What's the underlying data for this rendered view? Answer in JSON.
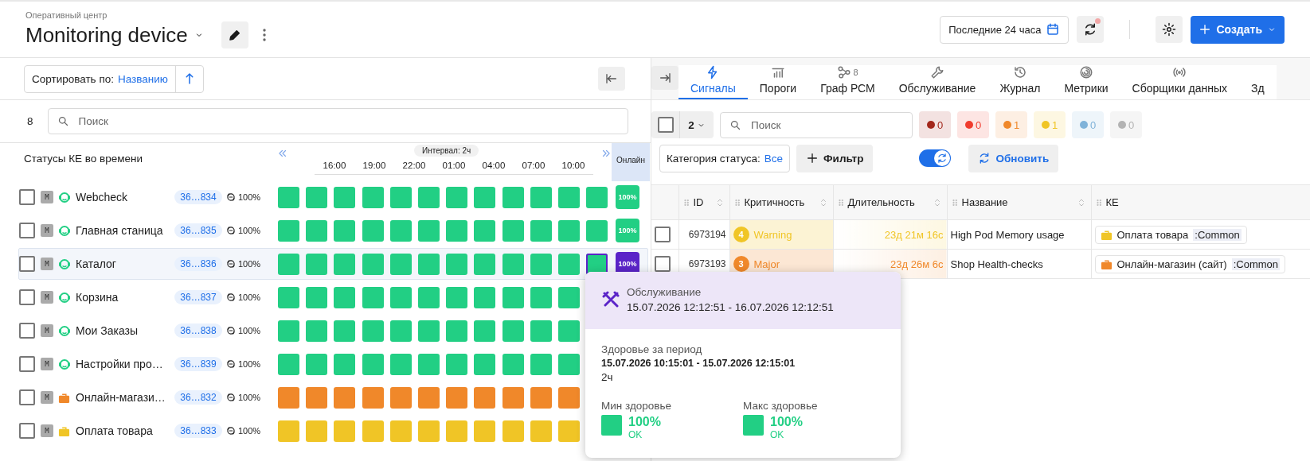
{
  "header": {
    "breadcrumb": "Оперативный центр",
    "title": "Monitoring device",
    "period": "Последние 24 часа",
    "create": "Создать",
    "refresh_alert": true
  },
  "sort": {
    "label": "Сортировать по:",
    "value": "Названию"
  },
  "search": {
    "count": "8",
    "placeholder": "Поиск"
  },
  "timeline": {
    "title": "Статусы КЕ во времени",
    "interval": "Интервал: 2ч",
    "ticks": [
      "16:00",
      "19:00",
      "22:00",
      "01:00",
      "04:00",
      "07:00",
      "10:00"
    ],
    "online_header": "Онлайн"
  },
  "items": [
    {
      "badge": "M",
      "kind": "web",
      "color": "#22cf84",
      "name": "Webcheck",
      "id": "36…834",
      "health": "100%",
      "selected": false,
      "online": "100%",
      "cells": [
        {
          "color": "#22cf84"
        },
        {
          "color": "#22cf84"
        },
        {
          "color": "#22cf84"
        },
        {
          "color": "#22cf84"
        },
        {
          "color": "#22cf84"
        },
        {
          "color": "#22cf84"
        },
        {
          "color": "#22cf84"
        },
        {
          "color": "#22cf84"
        },
        {
          "color": "#22cf84"
        },
        {
          "color": "#22cf84"
        },
        {
          "color": "#22cf84"
        },
        {
          "color": "#22cf84"
        }
      ]
    },
    {
      "badge": "M",
      "kind": "web",
      "color": "#22cf84",
      "name": "Главная станица",
      "id": "36…835",
      "health": "100%",
      "selected": false,
      "online": "100%",
      "cells": [
        {
          "color": "#22cf84"
        },
        {
          "color": "#22cf84"
        },
        {
          "color": "#22cf84"
        },
        {
          "color": "#22cf84"
        },
        {
          "color": "#22cf84"
        },
        {
          "color": "#22cf84"
        },
        {
          "color": "#22cf84"
        },
        {
          "color": "#22cf84"
        },
        {
          "color": "#22cf84"
        },
        {
          "color": "#22cf84"
        },
        {
          "color": "#22cf84"
        },
        {
          "color": "#22cf84"
        }
      ]
    },
    {
      "badge": "M",
      "kind": "web",
      "color": "#22cf84",
      "name": "Каталог",
      "id": "36…836",
      "health": "100%",
      "selected": true,
      "online": "100%",
      "cells": [
        {
          "color": "#22cf84"
        },
        {
          "color": "#22cf84"
        },
        {
          "color": "#22cf84"
        },
        {
          "color": "#22cf84"
        },
        {
          "color": "#22cf84"
        },
        {
          "color": "#22cf84"
        },
        {
          "color": "#22cf84"
        },
        {
          "color": "#22cf84"
        },
        {
          "color": "#22cf84"
        },
        {
          "color": "#22cf84"
        },
        {
          "color": "#22cf84"
        },
        {
          "color": "#22cf84"
        }
      ]
    },
    {
      "badge": "M",
      "kind": "web",
      "color": "#22cf84",
      "name": "Корзина",
      "id": "36…837",
      "health": "100%",
      "selected": false,
      "cells": [
        {
          "color": "#22cf84"
        },
        {
          "color": "#22cf84"
        },
        {
          "color": "#22cf84"
        },
        {
          "color": "#22cf84"
        },
        {
          "color": "#22cf84"
        },
        {
          "color": "#22cf84"
        },
        {
          "color": "#22cf84"
        },
        {
          "color": "#22cf84"
        },
        {
          "color": "#22cf84"
        },
        {
          "color": "#22cf84"
        },
        {
          "color": "#22cf84"
        }
      ]
    },
    {
      "badge": "M",
      "kind": "web",
      "color": "#22cf84",
      "name": "Мои Заказы",
      "id": "36…838",
      "health": "100%",
      "selected": false,
      "cells": [
        {
          "color": "#22cf84"
        },
        {
          "color": "#22cf84"
        },
        {
          "color": "#22cf84"
        },
        {
          "color": "#22cf84"
        },
        {
          "color": "#22cf84"
        },
        {
          "color": "#22cf84"
        },
        {
          "color": "#22cf84"
        },
        {
          "color": "#22cf84"
        },
        {
          "color": "#22cf84"
        },
        {
          "color": "#22cf84"
        },
        {
          "color": "#22cf84"
        }
      ]
    },
    {
      "badge": "M",
      "kind": "web",
      "color": "#22cf84",
      "name": "Настройки про…",
      "id": "36…839",
      "health": "100%",
      "selected": false,
      "cells": [
        {
          "color": "#22cf84"
        },
        {
          "color": "#22cf84"
        },
        {
          "color": "#22cf84"
        },
        {
          "color": "#22cf84"
        },
        {
          "color": "#22cf84"
        },
        {
          "color": "#22cf84"
        },
        {
          "color": "#22cf84"
        },
        {
          "color": "#22cf84"
        },
        {
          "color": "#22cf84"
        },
        {
          "color": "#22cf84"
        },
        {
          "color": "#22cf84"
        }
      ]
    },
    {
      "badge": "M",
      "kind": "service",
      "color": "#f0882a",
      "name": "Онлайн-магази…",
      "id": "36…832",
      "health": "100%",
      "selected": false,
      "cells": [
        {
          "color": "#f0882a"
        },
        {
          "color": "#f0882a"
        },
        {
          "color": "#f0882a"
        },
        {
          "color": "#f0882a"
        },
        {
          "color": "#f0882a"
        },
        {
          "color": "#f0882a"
        },
        {
          "color": "#f0882a"
        },
        {
          "color": "#f0882a"
        },
        {
          "color": "#f0882a"
        },
        {
          "color": "#f0882a"
        },
        {
          "color": "#f0882a"
        }
      ]
    },
    {
      "badge": "M",
      "kind": "service",
      "color": "#f0c526",
      "name": "Оплата товара",
      "id": "36…833",
      "health": "100%",
      "selected": false,
      "cells": [
        {
          "color": "#f0c526"
        },
        {
          "color": "#f0c526"
        },
        {
          "color": "#f0c526"
        },
        {
          "color": "#f0c526"
        },
        {
          "color": "#f0c526"
        },
        {
          "color": "#f0c526"
        },
        {
          "color": "#f0c526"
        },
        {
          "color": "#f0c526"
        },
        {
          "color": "#f0c526"
        },
        {
          "color": "#f0c526"
        },
        {
          "color": "#f0c526"
        }
      ]
    }
  ],
  "tabs": [
    {
      "kind": "bolt",
      "label": "Сигналы",
      "selected": true
    },
    {
      "kind": "bars",
      "label": "Пороги",
      "selected": false
    },
    {
      "kind": "graph",
      "label": "Граф РСМ",
      "badge": "8",
      "selected": false
    },
    {
      "kind": "wrench",
      "label": "Обслуживание",
      "selected": false
    },
    {
      "kind": "history",
      "label": "Журнал",
      "selected": false
    },
    {
      "kind": "spiral",
      "label": "Метрики",
      "selected": false
    },
    {
      "kind": "antenna",
      "label": "Сборщики данных",
      "selected": false
    },
    {
      "kind": "none",
      "label": "Зд",
      "selected": false
    }
  ],
  "signals": {
    "select_all": false,
    "count": "2",
    "placeholder": "Поиск",
    "counters": [
      {
        "value": "0",
        "color": "#a3281c"
      },
      {
        "value": "0",
        "color": "#f03c2e"
      },
      {
        "value": "1",
        "color": "#f0882a"
      },
      {
        "value": "1",
        "color": "#f0c526"
      },
      {
        "value": "0",
        "color": "#80b3d9"
      },
      {
        "value": "0",
        "color": "#b3b3b3"
      }
    ],
    "category_label": "Категория статуса:",
    "category_value": "Все",
    "filter": "Фильтр",
    "auto_refresh": true,
    "refresh": "Обновить"
  },
  "table": {
    "columns": [
      "ID",
      "Критичность",
      "Длительность",
      "Название",
      "КЕ"
    ],
    "rows": [
      {
        "checked": false,
        "id": "6973194",
        "rank": "4",
        "severity": "Warning",
        "color": "#f0c526",
        "duration": "23д 21м 16с",
        "name": "High Pod Memory usage",
        "ke": "Оплата товара",
        "ke_tag": ":Common"
      },
      {
        "checked": false,
        "id": "6973193",
        "rank": "3",
        "severity": "Major",
        "color": "#f0882a",
        "duration": "23д 26м 6с",
        "name": "Shop Health-checks",
        "ke": "Онлайн-магазин (сайт)",
        "ke_tag": ":Common"
      }
    ]
  },
  "tooltip": {
    "kind": "maintenance",
    "title": "Обслуживание",
    "range": "15.07.2026 12:12:51 - 16.07.2026 12:12:51",
    "period_label": "Здоровье за период",
    "period": "15.07.2026 10:15:01 - 15.07.2026 12:15:01",
    "duration": "2ч",
    "stats": [
      {
        "label": "Мин здоровье",
        "value": "100%",
        "status": "OK",
        "color": "#22cf84"
      },
      {
        "label": "Макс здоровье",
        "value": "100%",
        "status": "OK",
        "color": "#22cf84"
      }
    ]
  }
}
